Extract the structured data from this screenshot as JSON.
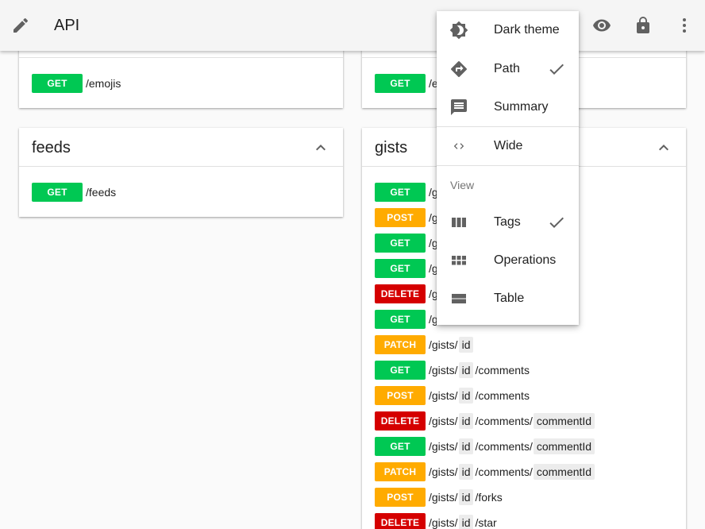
{
  "colors": {
    "get": "#00c853",
    "post": "#ffab00",
    "patch": "#ffab00",
    "delete": "#d50000"
  },
  "toolbar": {
    "title": "API",
    "icons": [
      "edit-icon",
      "visibility-icon",
      "lock-icon",
      "more-vert-icon"
    ]
  },
  "cards": {
    "top_left": {
      "method": "GET",
      "path": "/emojis"
    },
    "top_right": {
      "method": "GET",
      "path": "/e"
    },
    "feeds": {
      "title": "feeds",
      "ops": [
        {
          "method": "GET",
          "path": "/feeds"
        }
      ]
    },
    "gists": {
      "title": "gists",
      "ops": [
        {
          "method": "GET",
          "segments": [
            {
              "t": "/g"
            }
          ]
        },
        {
          "method": "POST",
          "segments": [
            {
              "t": "/g"
            }
          ]
        },
        {
          "method": "GET",
          "segments": [
            {
              "t": "/g"
            }
          ]
        },
        {
          "method": "GET",
          "segments": [
            {
              "t": "/g"
            }
          ]
        },
        {
          "method": "DELETE",
          "segments": [
            {
              "t": "/g"
            }
          ]
        },
        {
          "method": "GET",
          "segments": [
            {
              "t": "/g"
            }
          ]
        },
        {
          "method": "PATCH",
          "segments": [
            {
              "t": "/gists/"
            },
            {
              "p": "id"
            }
          ]
        },
        {
          "method": "GET",
          "segments": [
            {
              "t": "/gists/"
            },
            {
              "p": "id"
            },
            {
              "t": "/comments"
            }
          ]
        },
        {
          "method": "POST",
          "segments": [
            {
              "t": "/gists/"
            },
            {
              "p": "id"
            },
            {
              "t": "/comments"
            }
          ]
        },
        {
          "method": "DELETE",
          "segments": [
            {
              "t": "/gists/"
            },
            {
              "p": "id"
            },
            {
              "t": "/comments/"
            },
            {
              "p": "commentId"
            }
          ]
        },
        {
          "method": "GET",
          "segments": [
            {
              "t": "/gists/"
            },
            {
              "p": "id"
            },
            {
              "t": "/comments/"
            },
            {
              "p": "commentId"
            }
          ]
        },
        {
          "method": "PATCH",
          "segments": [
            {
              "t": "/gists/"
            },
            {
              "p": "id"
            },
            {
              "t": "/comments/"
            },
            {
              "p": "commentId"
            }
          ]
        },
        {
          "method": "POST",
          "segments": [
            {
              "t": "/gists/"
            },
            {
              "p": "id"
            },
            {
              "t": "/forks"
            }
          ]
        },
        {
          "method": "DELETE",
          "segments": [
            {
              "t": "/gists/"
            },
            {
              "p": "id"
            },
            {
              "t": "/star"
            }
          ]
        }
      ]
    }
  },
  "menu": {
    "dark_theme": "Dark theme",
    "path": "Path",
    "summary": "Summary",
    "wide": "Wide",
    "view_header": "View",
    "tags": "Tags",
    "operations": "Operations",
    "table": "Table",
    "path_checked": true,
    "tags_checked": true
  }
}
